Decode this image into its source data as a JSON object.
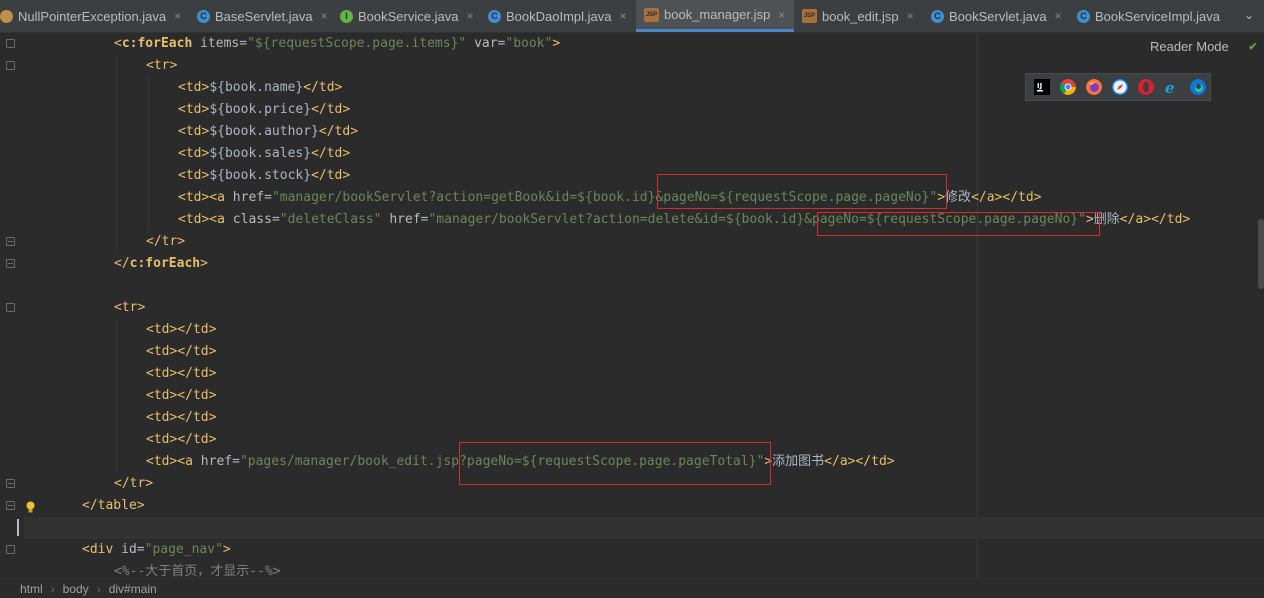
{
  "tabs": [
    {
      "label": "NullPointerException.java",
      "kind": "err",
      "icon": "exception-class-icon"
    },
    {
      "label": "BaseServlet.java",
      "kind": "cls",
      "icon": "class-icon"
    },
    {
      "label": "BookService.java",
      "kind": "int",
      "icon": "interface-icon"
    },
    {
      "label": "BookDaoImpl.java",
      "kind": "cls",
      "icon": "class-icon"
    },
    {
      "label": "book_manager.jsp",
      "kind": "jsp",
      "icon": "jsp-file-icon",
      "active": true
    },
    {
      "label": "book_edit.jsp",
      "kind": "jsp",
      "icon": "jsp-file-icon"
    },
    {
      "label": "BookServlet.java",
      "kind": "cls",
      "icon": "class-icon"
    },
    {
      "label": "BookServiceImpl.java",
      "kind": "cls",
      "icon": "class-icon"
    }
  ],
  "tab_close_glyph": "×",
  "tabs_more_glyph": "⌄",
  "reader_mode": "Reader Mode",
  "browsers": [
    "intellij-icon",
    "chrome-icon",
    "firefox-icon",
    "safari-icon",
    "opera-icon",
    "ie-icon",
    "edge-icon"
  ],
  "breadcrumb": [
    "html",
    "body",
    "div#main"
  ],
  "code": {
    "l1": {
      "open": "<",
      "tag": "c:forEach",
      "sp1": " ",
      "attr1": "items",
      "eq1": "=",
      "val1": "\"${requestScope.page.items}\"",
      "sp2": " ",
      "attr2": "var",
      "eq2": "=",
      "val2": "\"book\"",
      "close": ">"
    },
    "l2": {
      "text": "<tr>"
    },
    "l3": {
      "open": "<td>",
      "expr": "${book.name}",
      "close": "</td>"
    },
    "l4": {
      "open": "<td>",
      "expr": "${book.price}",
      "close": "</td>"
    },
    "l5": {
      "open": "<td>",
      "expr": "${book.author}",
      "close": "</td>"
    },
    "l6": {
      "open": "<td>",
      "expr": "${book.sales}",
      "close": "</td>"
    },
    "l7": {
      "open": "<td>",
      "expr": "${book.stock}",
      "close": "</td>"
    },
    "l8": {
      "open": "<td><a",
      "sp": " ",
      "attr": "href",
      "eq": "=",
      "val": "\"manager/bookServlet?action=getBook&id=${book.id}&pageNo=${requestScope.page.pageNo}\"",
      "gt": ">",
      "text": "修改",
      "close": "</a></td>"
    },
    "l9": {
      "open": "<td><a",
      "sp": " ",
      "attr": "class",
      "eq": "=",
      "val": "\"deleteClass\"",
      "sp2": " ",
      "attr2": "href",
      "eq2": "=",
      "val2": "\"manager/bookServlet?action=delete&id=${book.id}&pageNo=${requestScope.page.pageNo}\"",
      "gt": ">",
      "text": "删除",
      "close": "</a></td>"
    },
    "l10": {
      "text": "</tr>"
    },
    "l11": {
      "open": "</",
      "tag": "c:forEach",
      "close": ">"
    },
    "l13": {
      "text": "<tr>"
    },
    "empty_td": "<td></td>",
    "l19": {
      "open": "<td><a",
      "sp": " ",
      "attr": "href",
      "eq": "=",
      "val": "\"pages/manager/book_edit.jsp?pageNo=${requestScope.page.pageTotal}\"",
      "gt": ">",
      "text": "添加图书",
      "close": "</a></td>"
    },
    "l20": {
      "text": "</tr>"
    },
    "l21": {
      "text": "</table>"
    },
    "l23": {
      "open": "<div",
      "sp": " ",
      "attr": "id",
      "eq": "=",
      "val": "\"page_nav\"",
      "close": ">"
    },
    "l24": {
      "text": "<%--大于首页，才显示--%>"
    }
  },
  "colors": {
    "highlight_box": "#d82b2b",
    "tag": "#e8bf6a",
    "string": "#6a8759",
    "attr": "#bababa",
    "text": "#a9b7c6",
    "comment": "#808080"
  }
}
